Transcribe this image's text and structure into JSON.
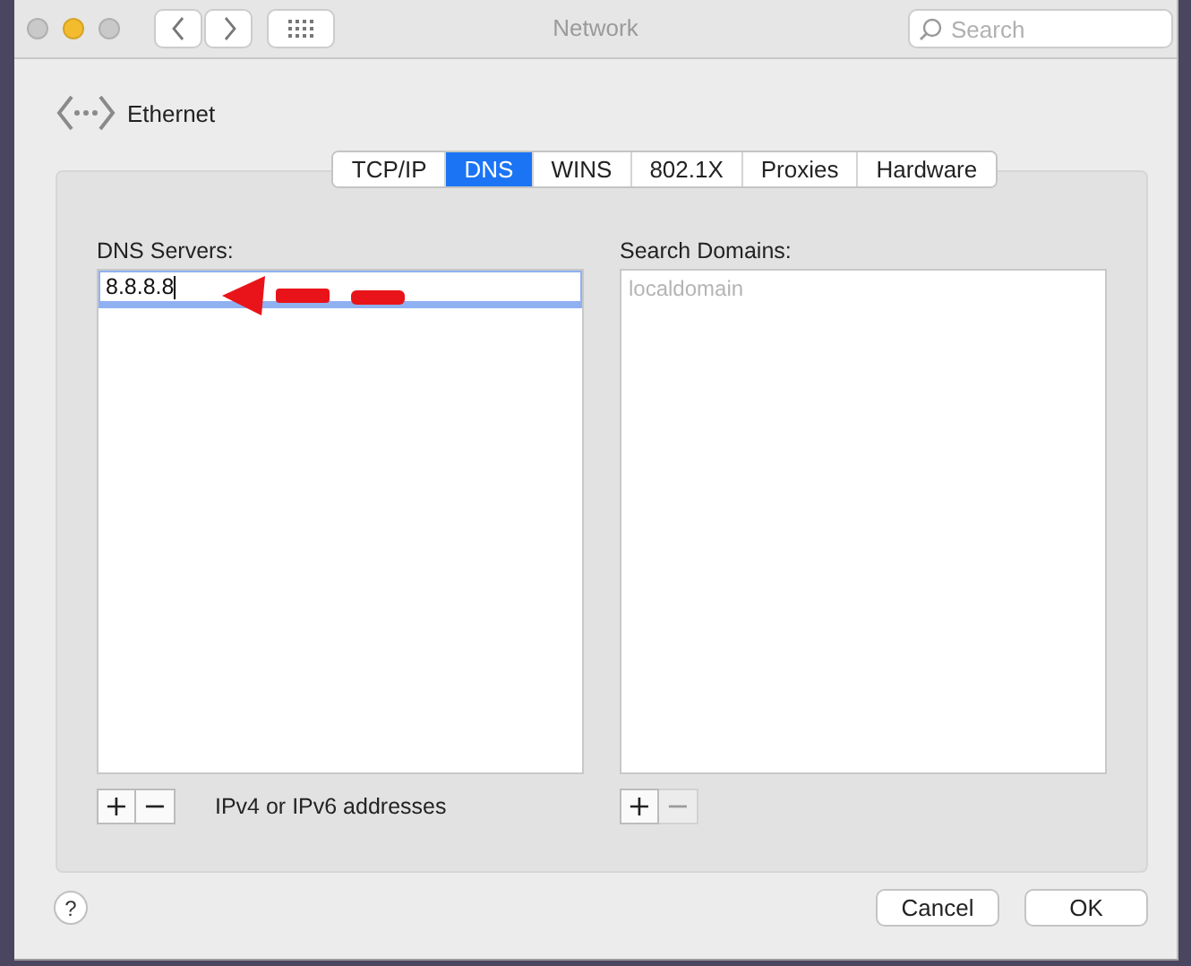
{
  "window": {
    "title": "Network",
    "traffic_lights": [
      {
        "color": "#c9c9c9"
      },
      {
        "color": "#f5bb2f"
      },
      {
        "color": "#c9c9c9"
      }
    ]
  },
  "search": {
    "placeholder": "Search"
  },
  "interface": {
    "name": "Ethernet"
  },
  "tabs": [
    {
      "label": "TCP/IP",
      "selected": false
    },
    {
      "label": "DNS",
      "selected": true
    },
    {
      "label": "WINS",
      "selected": false
    },
    {
      "label": "802.1X",
      "selected": false
    },
    {
      "label": "Proxies",
      "selected": false
    },
    {
      "label": "Hardware",
      "selected": false
    }
  ],
  "dns_servers": {
    "label": "DNS Servers:",
    "entries": [
      {
        "value": "8.8.8.8",
        "editing": true
      }
    ],
    "buttons": [
      {
        "symbol": "+",
        "disabled": false
      },
      {
        "symbol": "−",
        "disabled": false
      }
    ],
    "hint": "IPv4 or IPv6 addresses"
  },
  "search_domains": {
    "label": "Search Domains:",
    "placeholder": "localdomain",
    "buttons": [
      {
        "symbol": "+",
        "disabled": false
      },
      {
        "symbol": "−",
        "disabled": true
      }
    ]
  },
  "help": "?",
  "buttons": [
    "Cancel",
    "OK"
  ]
}
